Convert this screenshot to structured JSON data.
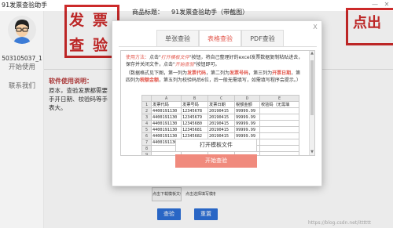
{
  "window": {
    "title": "91发票查验助手",
    "min": "—",
    "close": "✕"
  },
  "sidebar": {
    "user_id": "503105037_1",
    "items": [
      "开始使用",
      "联系我们"
    ]
  },
  "header": {
    "stamp_chars": [
      "发",
      "票",
      "查",
      "验"
    ],
    "product_label": "商品标题：",
    "product_name": "91发票查验助手（带截图）",
    "stamp2_text": "点出"
  },
  "help": {
    "title": "软件使用说明：",
    "body": "原本，查验发票都需要手开日期、校验码等手表大。"
  },
  "bottom": {
    "btn_a": "点击下载模板文件",
    "btn_b": "点击选择填写模板",
    "verify": "查验",
    "reset": "重置",
    "watermark": "https://blog.csdn.net/itttttt"
  },
  "dialog": {
    "close": "X",
    "tabs": [
      "单张查验",
      "表格查验",
      "PDF查验"
    ],
    "active_tab": 1,
    "usage": {
      "label": "使用方法：",
      "text1": "点击\"",
      "em1": "打开模板文件",
      "text2": "\"按钮，将自己整理好的excel发票数据复制粘贴进去，保存并关闭文件，点击\"",
      "em2": "开始查验",
      "text3": "\"按钮即可。"
    },
    "note": {
      "p1": "（数据格式见下图，第一列为",
      "b1": "发票代码",
      "p2": "，第二列为",
      "b2": "发票号码",
      "p3": "，第三列为",
      "b3": "开票日期",
      "p4": "，第四列为",
      "b4": "税额金额",
      "p5": "，第五列为校验码后6位，后一般无需填写，如需填写程序会提示。）"
    },
    "sheet": {
      "cols": [
        "",
        "A",
        "B",
        "C",
        "D",
        "E"
      ],
      "rows": [
        [
          "1",
          "发票代码",
          "发票号码",
          "发票日期",
          "税额金额",
          "校验码（无需填"
        ],
        [
          "2",
          "4400191130",
          "12345678",
          "20190415",
          "99999.99",
          ""
        ],
        [
          "3",
          "4400191130",
          "12345679",
          "20190415",
          "99999.99",
          ""
        ],
        [
          "4",
          "4400191130",
          "12345680",
          "20190415",
          "99999.99",
          ""
        ],
        [
          "5",
          "4400191130",
          "12345681",
          "20190415",
          "99999.99",
          ""
        ],
        [
          "6",
          "4400191130",
          "12345682",
          "20190415",
          "99999.99",
          ""
        ],
        [
          "7",
          "4400191130",
          "12345683",
          "20190415",
          "99999.99",
          ""
        ],
        [
          "8",
          "",
          "",
          "",
          "",
          ""
        ],
        [
          "9",
          "",
          "",
          "",
          "",
          ""
        ],
        [
          "10",
          "",
          "",
          "",
          "",
          ""
        ]
      ]
    },
    "open_button": "打开模板文件",
    "start_button": "开始查验"
  }
}
